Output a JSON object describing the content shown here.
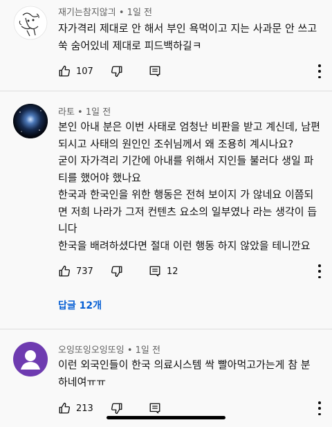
{
  "comments": [
    {
      "author": "재기는참지않긔",
      "sep": " • ",
      "time": "1일 전",
      "lines": [
        "자가격리 제대로 안 해서 부인 욕먹이고 지는 사과문 안 쓰고",
        "쑥 숨어있네 제대로 피드백하길ㅋ"
      ],
      "likes": "107",
      "avatar_icon": "sketch-drawing-avatar"
    },
    {
      "author": "라토",
      "sep": " • ",
      "time": "1일 전",
      "lines": [
        "본인 아내 분은 이번 사태로 엄청난 비판을 받고 계신데, 남편",
        "되시고 사태의 원인인 조쉬님께서 왜 조용히 계시나요?",
        "굳이 자가격리 기간에 아내를 위해서 지인들 불러다 생일 파",
        "티를 했어야 했나요",
        "한국과 한국인을 위한 행동은 전혀 보이지 가 않네요 이쯤되",
        "면 저희 나라가 그저 컨텐츠 요소의 일부였나 라는 생각이 듭",
        "니다",
        "한국을 배려하셨다면 절대 이런 행동 하지 않았을 테니깐요"
      ],
      "likes": "737",
      "reply_count": "12",
      "replies_link": "답글 12개",
      "avatar_icon": "galaxy-avatar"
    },
    {
      "author": "오잉또잉오잉또잉",
      "sep": " • ",
      "time": "1일 전",
      "lines": [
        "이런 외국인들이 한국 의료시스템 싹 빨아먹고가는게 참 분",
        "하네여ㅠㅠ"
      ],
      "likes": "213",
      "avatar_icon": "default-person-avatar"
    }
  ],
  "colors": {
    "background": "#f9f9f9",
    "meta_text": "#606060",
    "link_blue": "#065fd4",
    "default_avatar_bg": "#6e3bb0"
  }
}
